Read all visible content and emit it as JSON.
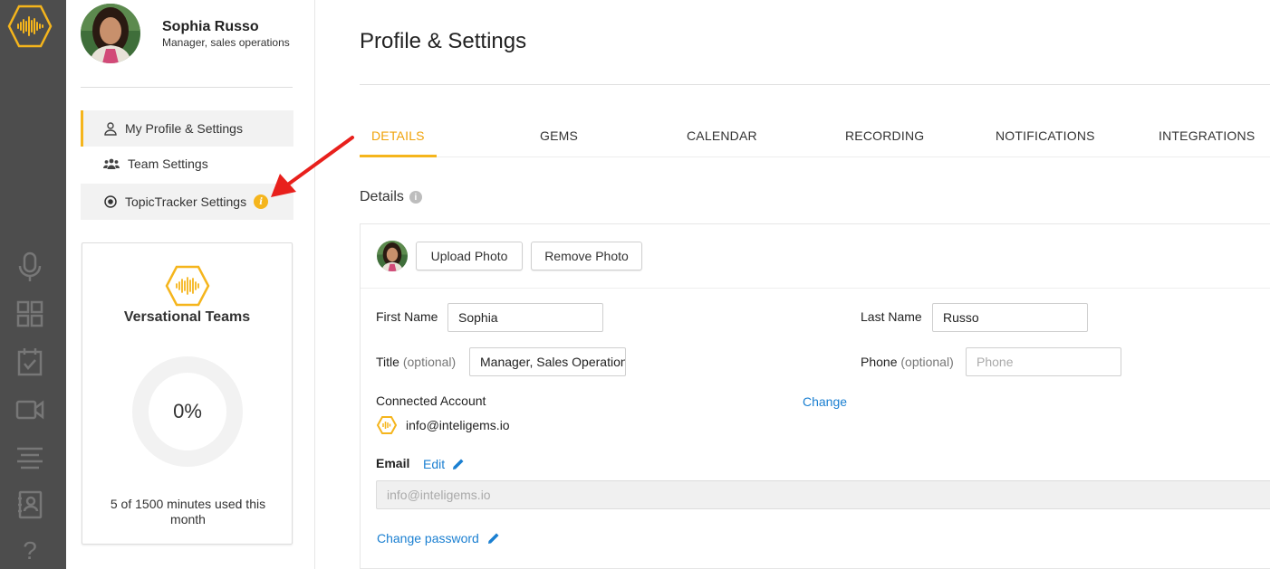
{
  "user": {
    "name": "Sophia Russo",
    "role": "Manager, sales operations"
  },
  "rail": {
    "icons": [
      "logo-icon",
      "microphone-icon",
      "grid-icon",
      "calendar-check-icon",
      "video-icon",
      "list-icon",
      "contacts-icon",
      "help-icon"
    ],
    "help_glyph": "?"
  },
  "sidebar": {
    "items": [
      {
        "label": "My Profile & Settings",
        "icon": "person-icon",
        "active": true
      },
      {
        "label": "Team Settings",
        "icon": "team-icon",
        "active": false
      },
      {
        "label": "TopicTracker Settings",
        "icon": "radio-target-icon",
        "active": false,
        "badge": "i"
      }
    ]
  },
  "team": {
    "name": "Versational Teams",
    "usage_pct": "0%",
    "usage_fraction": 0,
    "usage_text": "5 of 1500 minutes used this month"
  },
  "header": {
    "title": "Profile & Settings"
  },
  "tabs": [
    {
      "label": "DETAILS",
      "active": true
    },
    {
      "label": "GEMS",
      "active": false
    },
    {
      "label": "CALENDAR",
      "active": false
    },
    {
      "label": "RECORDING",
      "active": false
    },
    {
      "label": "NOTIFICATIONS",
      "active": false
    },
    {
      "label": "INTEGRATIONS",
      "active": false
    }
  ],
  "details": {
    "section_label": "Details",
    "help_glyph": "i",
    "upload_photo": "Upload Photo",
    "remove_photo": "Remove Photo",
    "first_name_label": "First Name",
    "first_name_value": "Sophia",
    "last_name_label": "Last Name",
    "last_name_value": "Russo",
    "title_label": "Title",
    "title_optional": "(optional)",
    "title_value": "Manager, Sales Operations",
    "phone_label": "Phone",
    "phone_optional": "(optional)",
    "phone_placeholder": "Phone",
    "connected_account_label": "Connected Account",
    "change_link": "Change",
    "connected_email": "info@inteligems.io",
    "email_label": "Email",
    "edit_link": "Edit",
    "email_value": "info@inteligems.io",
    "change_password_link": "Change password"
  },
  "colors": {
    "accent": "#f5b51c",
    "rail": "#4d4d4d",
    "link": "#1a7fd1",
    "annotation_arrow": "#e8201c"
  }
}
